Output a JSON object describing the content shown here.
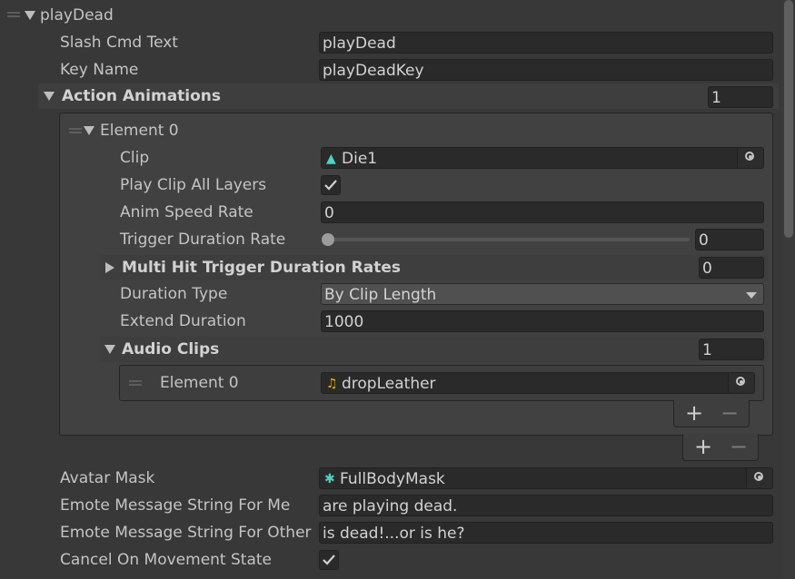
{
  "section": {
    "title": "playDead"
  },
  "fields": {
    "slash_cmd_text": {
      "label": "Slash Cmd Text",
      "value": "playDead"
    },
    "key_name": {
      "label": "Key Name",
      "value": "playDeadKey"
    }
  },
  "action_animations": {
    "label": "Action Animations",
    "size": "1",
    "element": {
      "label": "Element 0",
      "clip": {
        "label": "Clip",
        "value": "Die1",
        "icon": "animation-clip-icon"
      },
      "play_clip_all_layers": {
        "label": "Play Clip All Layers",
        "checked": true
      },
      "anim_speed_rate": {
        "label": "Anim Speed Rate",
        "value": "0"
      },
      "trigger_duration_rate": {
        "label": "Trigger Duration Rate",
        "value": "0",
        "slider_fraction": 0
      },
      "multi_hit": {
        "label": "Multi Hit Trigger Duration Rates",
        "size": "0"
      },
      "duration_type": {
        "label": "Duration Type",
        "value": "By Clip Length"
      },
      "extend_duration": {
        "label": "Extend Duration",
        "value": "1000"
      },
      "audio_clips": {
        "label": "Audio Clips",
        "size": "1",
        "element": {
          "label": "Element 0",
          "value": "dropLeather",
          "icon": "audio-clip-icon"
        }
      }
    }
  },
  "list_controls": {
    "plus": "+",
    "minus": "−"
  },
  "avatar_mask": {
    "label": "Avatar Mask",
    "value": "FullBodyMask",
    "icon": "avatar-mask-icon"
  },
  "emote_me": {
    "label": "Emote Message String For Me",
    "value": "are playing dead."
  },
  "emote_other": {
    "label": "Emote Message String For Other",
    "value": "is dead!...or is he?"
  },
  "cancel_on_movement": {
    "label": "Cancel On Movement State",
    "checked": true
  },
  "colors": {
    "background": "#383838",
    "field": "#2a2a2a",
    "clip_icon": "#4fd1c5",
    "audio_icon": "#f0b000"
  }
}
